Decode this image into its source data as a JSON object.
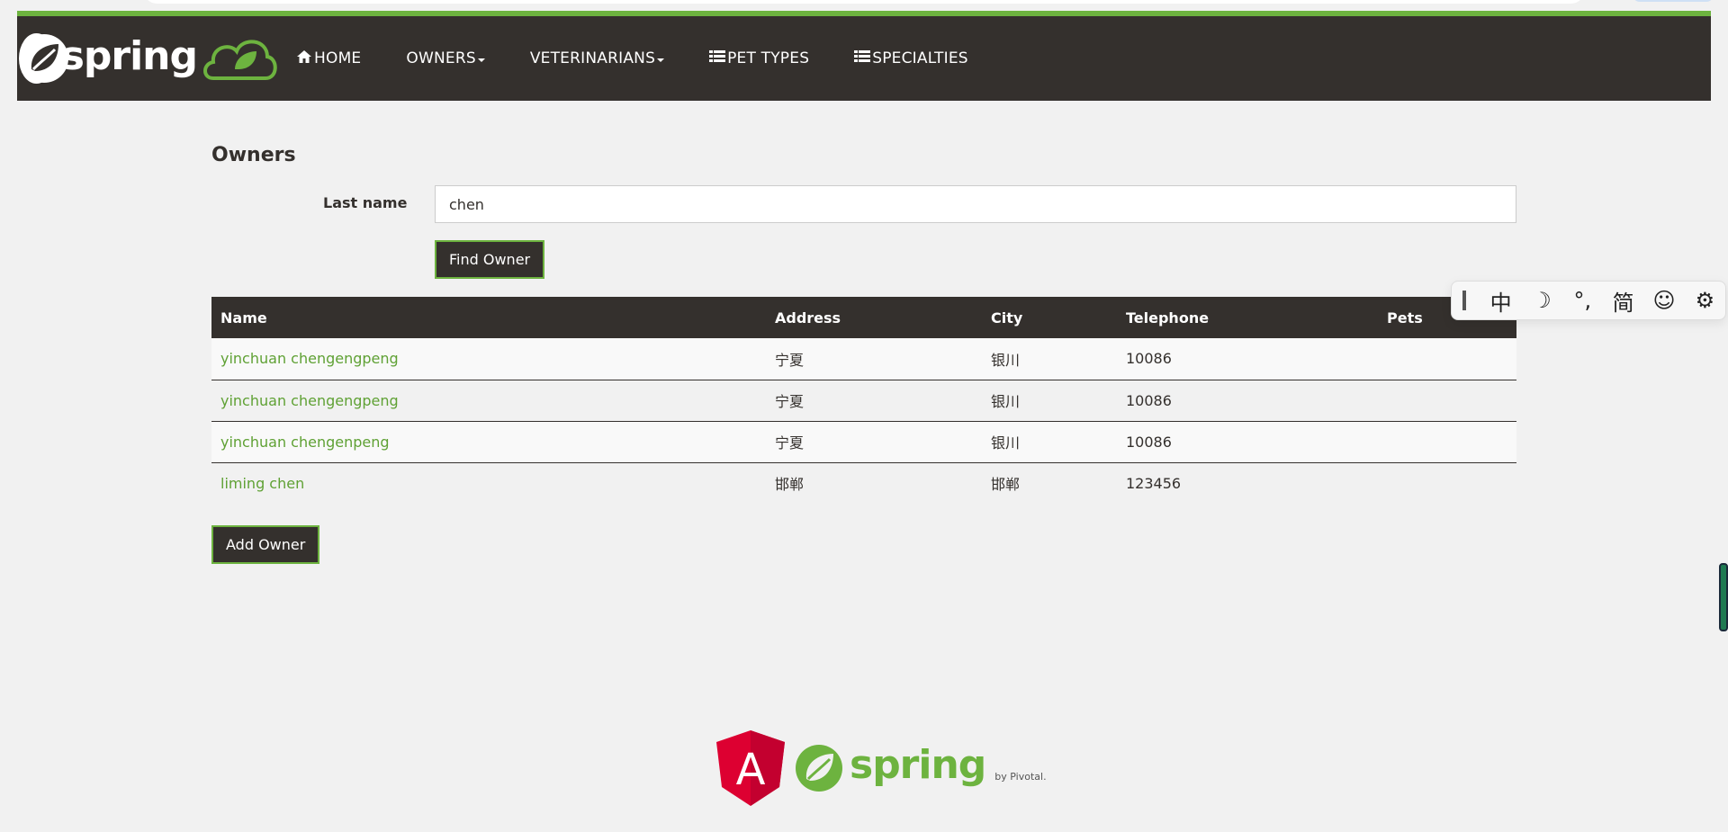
{
  "nav": {
    "brand": "spring",
    "items": [
      {
        "label": "HOME",
        "icon": "home-icon",
        "dropdown": false
      },
      {
        "label": "OWNERS",
        "icon": "",
        "dropdown": true
      },
      {
        "label": "VETERINARIANS",
        "icon": "",
        "dropdown": true
      },
      {
        "label": "PET TYPES",
        "icon": "list-icon",
        "dropdown": false
      },
      {
        "label": "SPECIALTIES",
        "icon": "list-icon",
        "dropdown": false
      }
    ]
  },
  "page": {
    "title": "Owners",
    "search": {
      "label": "Last name",
      "value": "chen"
    },
    "find_button": "Find Owner",
    "add_button": "Add Owner"
  },
  "table": {
    "columns": [
      "Name",
      "Address",
      "City",
      "Telephone",
      "Pets"
    ],
    "rows": [
      {
        "name": "yinchuan chengengpeng",
        "address": "宁夏",
        "city": "银川",
        "telephone": "10086",
        "pets": ""
      },
      {
        "name": "yinchuan chengengpeng",
        "address": "宁夏",
        "city": "银川",
        "telephone": "10086",
        "pets": ""
      },
      {
        "name": "yinchuan chengenpeng",
        "address": "宁夏",
        "city": "银川",
        "telephone": "10086",
        "pets": ""
      },
      {
        "name": "liming chen",
        "address": "邯郸",
        "city": "邯郸",
        "telephone": "123456",
        "pets": ""
      }
    ]
  },
  "ime_toolbar": {
    "items": [
      "中",
      "☽",
      "°,",
      "简",
      "☺",
      "⚙"
    ]
  },
  "footer": {
    "angular_letter": "A",
    "spring_text": "spring",
    "pivotal_text": "by Pivotal."
  },
  "colors": {
    "nav_bg": "#34302d",
    "accent": "#6db33f",
    "link": "#5fa134",
    "page_bg": "#f1f1f1"
  }
}
